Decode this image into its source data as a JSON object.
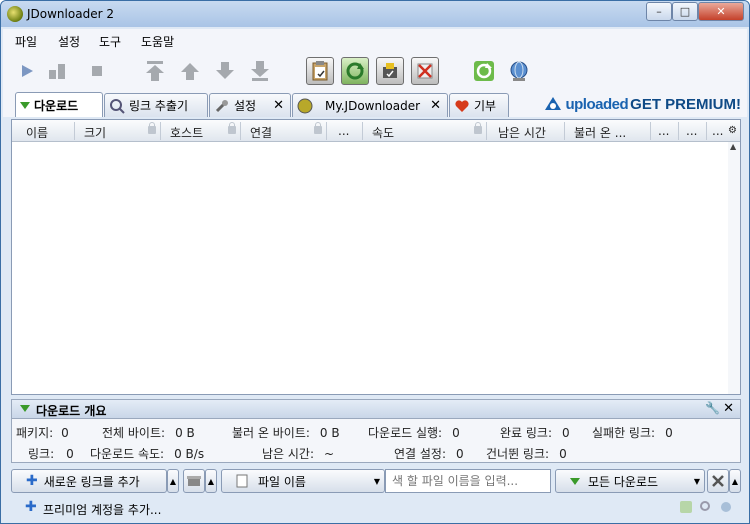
{
  "window": {
    "title": "JDownloader 2",
    "min": "–",
    "max": "□",
    "close": "✕"
  },
  "menu": [
    "파일",
    "설정",
    "도구",
    "도움말"
  ],
  "tabs": [
    {
      "label": "다운로드"
    },
    {
      "label": "링크 추출기"
    },
    {
      "label": "설정",
      "close": "✕"
    },
    {
      "label": "My.JDownloader",
      "close": "✕"
    },
    {
      "label": "기부"
    }
  ],
  "premium": {
    "brand": "uploaded",
    "cta": "GET PREMIUM!"
  },
  "columns": [
    "이름",
    "크기",
    "호스트",
    "연결",
    "...",
    "속도",
    "남은 시간",
    "불러 온 ...",
    "...",
    "...",
    "..."
  ],
  "overview": {
    "title": "다운로드 개요",
    "row1": [
      {
        "label": "패키지:",
        "value": "0"
      },
      {
        "label": "전체 바이트:",
        "value": "0 B"
      },
      {
        "label": "불러 온 바이트:",
        "value": "0 B"
      },
      {
        "label": "다운로드 실행:",
        "value": "0"
      },
      {
        "label": "완료 링크:",
        "value": "0"
      },
      {
        "label": "실패한 링크:",
        "value": "0"
      }
    ],
    "row2": [
      {
        "label": "링크:",
        "value": "0"
      },
      {
        "label": "다운로드 속도:",
        "value": "0 B/s"
      },
      {
        "label": "남은 시간:",
        "value": "~"
      },
      {
        "label": "연결 설정:",
        "value": "0"
      },
      {
        "label": "건너뛴 링크:",
        "value": "0"
      }
    ]
  },
  "bottom": {
    "add_links": "새로운 링크를 추가",
    "sort_field": "파일 이름",
    "search_placeholder": "색 할 파일 이름을 입력...",
    "filter": "모든 다운로드"
  },
  "status": {
    "premium_account": "프리미엄 계정을 추가..."
  }
}
